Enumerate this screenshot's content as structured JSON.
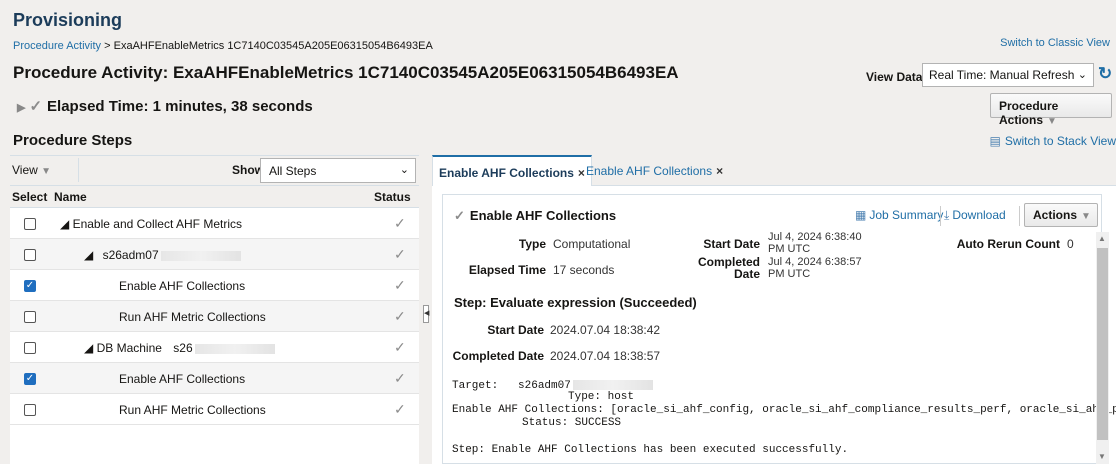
{
  "header": {
    "title": "Provisioning",
    "breadcrumb_link": "Procedure Activity",
    "breadcrumb_sep": ">",
    "breadcrumb_current": "ExaAHFEnableMetrics 1C7140C03545A205E06315054B6493EA",
    "switch_classic": "Switch to Classic View",
    "page_title": "Procedure Activity: ExaAHFEnableMetrics 1C7140C03545A205E06315054B6493EA",
    "view_data_label": "View Data",
    "view_data_value": "Real Time: Manual Refresh",
    "elapsed": "Elapsed Time: 1 minutes, 38 seconds",
    "procedure_actions": "Procedure Actions"
  },
  "steps": {
    "heading": "Procedure Steps",
    "switch_stack": "Switch to Stack View",
    "view_label": "View",
    "show_label": "Show",
    "show_value": "All Steps",
    "columns": [
      "Select",
      "Name",
      "Status"
    ],
    "rows": [
      {
        "name": "Enable and Collect AHF Metrics",
        "checked": false
      },
      {
        "name": "s26adm07",
        "checked": false
      },
      {
        "name": "Enable AHF Collections",
        "checked": true
      },
      {
        "name": "Run AHF Metric Collections",
        "checked": false
      },
      {
        "name": "DB Machine",
        "name_suffix": "s26",
        "checked": false
      },
      {
        "name": "Enable AHF Collections",
        "checked": true
      },
      {
        "name": "Run AHF Metric Collections",
        "checked": false
      }
    ]
  },
  "detail": {
    "tabs": [
      "Enable AHF Collections",
      "Enable AHF Collections"
    ],
    "title": "Enable AHF Collections",
    "job_summary": "Job Summary",
    "download": "Download",
    "actions": "Actions",
    "type_label": "Type",
    "type_value": "Computational",
    "elapsed_label": "Elapsed Time",
    "elapsed_value": "17 seconds",
    "start_label": "Start Date",
    "start_value_1": "Jul 4, 2024 6:38:40",
    "start_value_2": "PM UTC",
    "completed_label_1": "Completed",
    "completed_label_2": "Date",
    "completed_value_1": "Jul 4, 2024 6:38:57",
    "completed_value_2": "PM UTC",
    "auto_rerun_label": "Auto Rerun Count",
    "auto_rerun_value": "0",
    "step_heading": "Step: Evaluate expression (Succeeded)",
    "step_start_label": "Start Date",
    "step_start_value": "2024.07.04 18:38:42",
    "step_completed_label": "Completed Date",
    "step_completed_value": "2024.07.04 18:38:57",
    "log_target_label": "Target:",
    "log_target_value": "s26adm07",
    "log_type": "Type: host",
    "log_enable": "Enable AHF Collections: [oracle_si_ahf_config, oracle_si_ahf_compliance_results_perf, oracle_si_ahf_perf]",
    "log_status": "Status: SUCCESS",
    "log_final": "Step: Enable AHF Collections has been executed successfully."
  }
}
